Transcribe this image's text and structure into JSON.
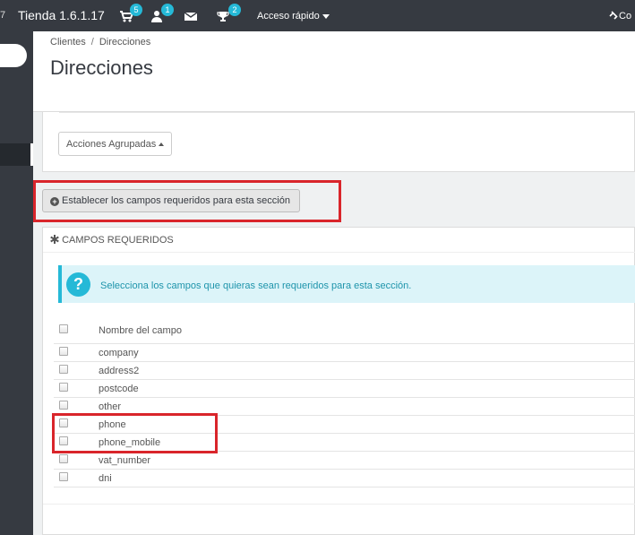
{
  "topbar": {
    "version_fragment": "7",
    "shop_name": "Tienda 1.6.1.17",
    "orders_badge": "5",
    "customers_badge": "1",
    "messages_badge": "",
    "trophy_badge": "2",
    "quick_access": "Acceso rápido",
    "right_fragment": "Co",
    "icons": [
      "cart-icon",
      "user-icon",
      "envelope-icon",
      "trophy-icon",
      "link-icon"
    ],
    "accent": "#25b9d7"
  },
  "breadcrumb": {
    "first": "Clientes",
    "sep": "/",
    "second": "Direcciones"
  },
  "page_title": "Direcciones",
  "bulk_actions_label": "Acciones Agrupadas",
  "required_button_label": "Establecer los campos requeridos para esta sección",
  "required_panel": {
    "heading": "CAMPOS REQUERIDOS",
    "alert_text": "Selecciona los campos que quieras sean requeridos para esta sección.",
    "column_header": "Nombre del campo",
    "fields": [
      "company",
      "address2",
      "postcode",
      "other",
      "phone",
      "phone_mobile",
      "vat_number",
      "dni"
    ]
  },
  "highlight_color": "#d9252b"
}
